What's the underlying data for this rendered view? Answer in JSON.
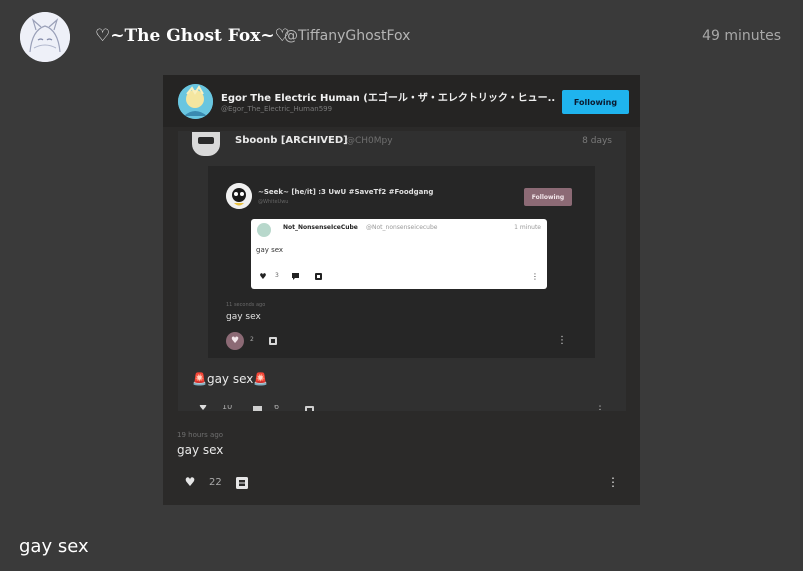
{
  "post": {
    "display_name": "♡~The Ghost Fox~♡",
    "handle": "@TiffanyGhostFox",
    "time": "49 minutes",
    "body": "gay sex"
  },
  "embed": {
    "author_name": "Egor The Electric Human (エゴール・ザ・エレクトリック・ヒュー...",
    "author_handle": "@Egor_The_Electric_Human599",
    "follow_label": "Following",
    "time": "19 hours ago",
    "body": "gay sex",
    "like_count": "22",
    "inner": {
      "author_name": "Sboonb [ARCHIVED]",
      "author_handle": "@CH0Mpy",
      "time": "8 days",
      "body": "gay sex",
      "siren": "🚨",
      "like_count": "10",
      "comment_count": "6",
      "inner": {
        "author_name": "~Seek~ [he/it] :3 UwU #SaveTf2 #Foodgang",
        "author_handle": "@WhiteUwu",
        "follow_label": "Following",
        "time": "11 seconds ago",
        "body": "gay sex",
        "like_count": "2",
        "inner": {
          "author_name": "Not_NonsenseIceCube",
          "author_handle": "@Not_nonsenseicecube",
          "time": "1 minute",
          "body": "gay sex",
          "like_count": "3"
        }
      }
    }
  },
  "icons": {
    "heart": "heart-icon",
    "comment": "comment-icon",
    "repost": "repost-icon",
    "more": "more-icon"
  }
}
